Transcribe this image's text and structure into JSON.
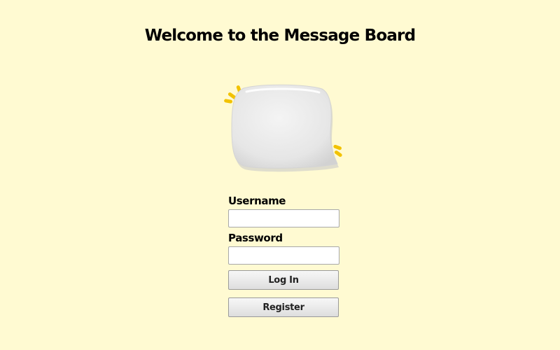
{
  "page": {
    "title": "Welcome to the Message Board"
  },
  "illustration": {
    "icon": "speech-bubble-icon",
    "bubble_color": "#ececec",
    "accent_color": "#f2c200"
  },
  "login_form": {
    "username_label": "Username",
    "username_value": "",
    "password_label": "Password",
    "password_value": "",
    "login_button": "Log In",
    "register_button": "Register"
  },
  "colors": {
    "background": "#fffad2",
    "text": "#000000"
  }
}
